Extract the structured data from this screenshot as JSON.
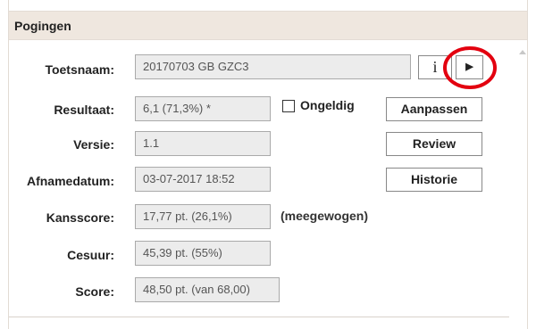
{
  "panel": {
    "title": "Pogingen"
  },
  "fields": {
    "toetsnaam": {
      "label": "Toetsnaam:",
      "value": "20170703 GB GZC3"
    },
    "resultaat": {
      "label": "Resultaat:",
      "value": "6,1 (71,3%) *"
    },
    "versie": {
      "label": "Versie:",
      "value": "1.1"
    },
    "afnamedatum": {
      "label": "Afnamedatum:",
      "value": "03-07-2017 18:52"
    },
    "kansscore": {
      "label": "Kansscore:",
      "value": "17,77 pt. (26,1%)"
    },
    "cesuur": {
      "label": "Cesuur:",
      "value": "45,39 pt. (55%)"
    },
    "score": {
      "label": "Score:",
      "value": "48,50 pt. (van 68,00)"
    }
  },
  "buttons": {
    "info": "i",
    "play": "▶",
    "aanpassen": "Aanpassen",
    "review": "Review",
    "historie": "Historie"
  },
  "ongeldig": {
    "label": "Ongeldig",
    "checked": false
  },
  "kansscore_note": "(meegewogen)",
  "colors": {
    "header_bg": "#efe7df",
    "field_bg": "#ececec",
    "highlight_circle": "#e3000f"
  }
}
